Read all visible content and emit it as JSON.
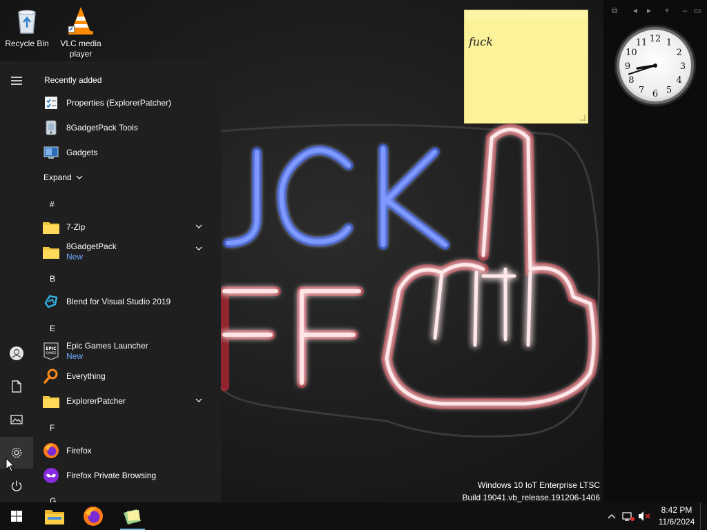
{
  "desktop": {
    "icons": [
      {
        "label": "Recycle Bin",
        "icon": "recycle-bin-icon"
      },
      {
        "label": "VLC media player",
        "icon": "vlc-cone-icon"
      }
    ],
    "wallpaper_line1": "JCK",
    "wallpaper_line2": "FF",
    "neon_blue": "#3a6bff",
    "neon_red": "#ff2a3a"
  },
  "sticky_note": {
    "text": "fuck",
    "color": "#fbf29a"
  },
  "gadgets": {
    "toolbar": [
      "⧉",
      "◂",
      "▸",
      "+",
      "–",
      "▭"
    ],
    "clock": {
      "hour": 8,
      "minute": 42,
      "numerals": [
        "12",
        "1",
        "2",
        "3",
        "4",
        "5",
        "6",
        "7",
        "8",
        "9",
        "10",
        "11"
      ]
    }
  },
  "start_menu": {
    "recently_added_title": "Recently added",
    "recent": [
      {
        "label": "Properties (ExplorerPatcher)",
        "icon": "properties-icon"
      },
      {
        "label": "8GadgetPack Tools",
        "icon": "gadgetpack-tools-icon"
      },
      {
        "label": "Gadgets",
        "icon": "gadgets-icon"
      }
    ],
    "expand_label": "Expand",
    "groups": [
      {
        "letter": "#"
      },
      {
        "letter": "B"
      },
      {
        "letter": "E"
      },
      {
        "letter": "F"
      },
      {
        "letter": "G"
      }
    ],
    "apps": [
      {
        "label": "7-Zip",
        "icon": "folder-icon",
        "sub": "",
        "chevron": true
      },
      {
        "label": "8GadgetPack",
        "icon": "folder-icon",
        "sub": "New",
        "chevron": true
      },
      {
        "label": "Blend for Visual Studio 2019",
        "icon": "blend-icon",
        "sub": "",
        "chevron": false
      },
      {
        "label": "Epic Games Launcher",
        "icon": "epic-games-icon",
        "sub": "New",
        "chevron": false
      },
      {
        "label": "Everything",
        "icon": "everything-search-icon",
        "sub": "",
        "chevron": false
      },
      {
        "label": "ExplorerPatcher",
        "icon": "folder-icon",
        "sub": "",
        "chevron": true
      },
      {
        "label": "Firefox",
        "icon": "firefox-icon",
        "sub": "",
        "chevron": false
      },
      {
        "label": "Firefox Private Browsing",
        "icon": "firefox-private-icon",
        "sub": "",
        "chevron": false
      }
    ],
    "epic_icon_text": "EPIC GAMES",
    "rail": [
      "hamburger-icon",
      "user-icon",
      "documents-icon",
      "pictures-icon",
      "settings-icon",
      "power-icon"
    ]
  },
  "watermark": {
    "line1": "Windows 10 IoT Enterprise LTSC",
    "line2": "Build 19041.vb_release.191206-1406"
  },
  "taskbar": {
    "pinned": [
      "start-button",
      "file-explorer",
      "firefox",
      "gadgets"
    ],
    "time": "8:42 PM",
    "date": "11/6/2024"
  }
}
